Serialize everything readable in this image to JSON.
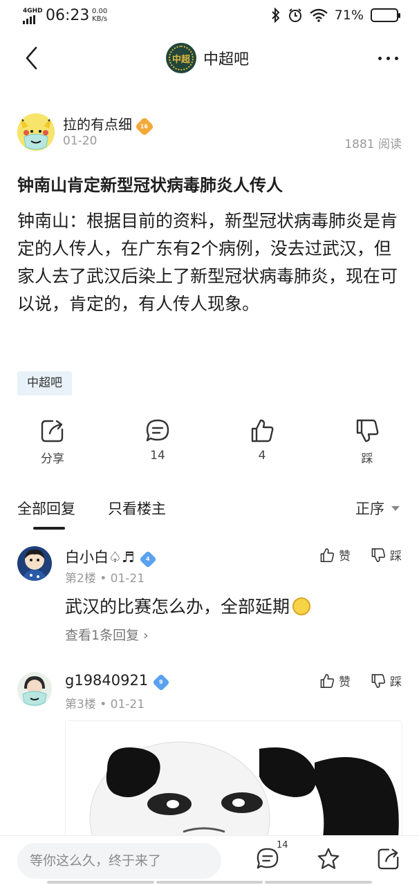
{
  "status_bar": {
    "network": "4GHD",
    "time": "06:23",
    "speed_value": "0.00",
    "speed_unit": "KB/s",
    "battery_pct": "71%",
    "battery_level": 0.71,
    "icons": [
      "bluetooth-icon",
      "alarm-icon",
      "wifi-icon",
      "battery-icon"
    ]
  },
  "nav": {
    "title": "中超吧",
    "logo_text": "中超"
  },
  "post": {
    "author": "拉的有点细",
    "author_level": "16",
    "date": "01-20",
    "views": "1881 阅读",
    "title": "钟南山肯定新型冠状病毒肺炎人传人",
    "body": "钟南山：根据目前的资料，新型冠状病毒肺炎是肯定的人传人，在广东有2个病例，没去过武汉，但家人去了武汉后染上了新型冠状病毒肺炎，现在可以说，肯定的，有人传人现象。",
    "tag": "中超吧"
  },
  "actions": {
    "share": "分享",
    "comments": "14",
    "likes": "4",
    "dislike": "踩"
  },
  "tabs": {
    "all": "全部回复",
    "host_only": "只看楼主",
    "order": "正序"
  },
  "replies": [
    {
      "name": "白小白♤♬",
      "level": "4",
      "floor_date": "第2楼 • 01-21",
      "like": "赞",
      "dislike": "踩",
      "text": "武汉的比赛怎么办，全部延期",
      "more": "查看1条回复 ›"
    },
    {
      "name": "g19840921",
      "level": "9",
      "floor_date": "第3楼 • 01-21",
      "like": "赞",
      "dislike": "踩"
    }
  ],
  "bottom": {
    "placeholder": "等你这么久，终于来了",
    "comment_count": "14"
  },
  "colors": {
    "accent_blue": "#5aa2f0",
    "level_orange": "#f3a93a",
    "tag_bg": "#e8f2f8",
    "text": "#1e1e1e",
    "muted": "#9a9a9a"
  }
}
